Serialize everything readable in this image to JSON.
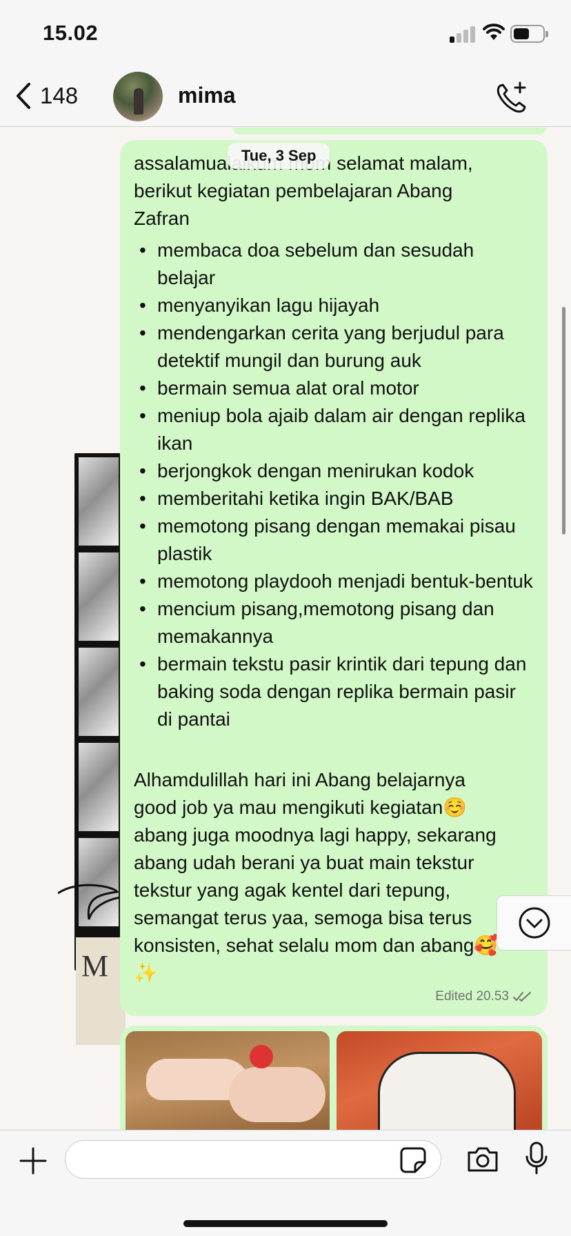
{
  "status_bar": {
    "time": "15.02"
  },
  "header": {
    "back_count": "148",
    "contact_name": "mima"
  },
  "chat": {
    "date_chip": "Tue, 3 Sep",
    "message": {
      "intro": "assalamualaikum mom selamat malam,\nberikut kegiatan pembelajaran Abang\nZafran",
      "activities": [
        "membaca doa sebelum dan sesudah belajar",
        "menyanyikan lagu hijayah",
        "mendengarkan cerita yang berjudul para detektif mungil dan burung auk",
        "bermain semua alat oral motor",
        "meniup bola ajaib dalam air dengan replika ikan",
        "berjongkok dengan menirukan kodok",
        "memberitahi ketika ingin BAK/BAB",
        "memotong pisang  dengan memakai pisau plastik",
        "memotong playdooh menjadi bentuk-bentuk",
        "mencium pisang,memotong pisang dan memakannya",
        "bermain tekstu pasir krintik dari tepung dan baking soda dengan replika bermain pasir di pantai"
      ],
      "closing": "Alhamdulillah hari ini Abang belajarnya\ngood job ya mau mengikuti kegiatan☺️\nabang juga moodnya lagi happy, sekarang\nabang udah berani ya buat main tekstur\ntekstur yang agak kentel dari tepung,\nsemangat terus yaa, semoga bisa terus\nkonsisten, sehat selalu mom dan abang🥰",
      "closing_tail": "✨",
      "edited_label": "Edited 20.53"
    }
  },
  "composer": {
    "input_value": "",
    "input_placeholder": ""
  },
  "colors": {
    "bubble": "#d2f8c8",
    "header_bg": "#f6f6f6",
    "chat_bg": "#f7f4f1"
  }
}
